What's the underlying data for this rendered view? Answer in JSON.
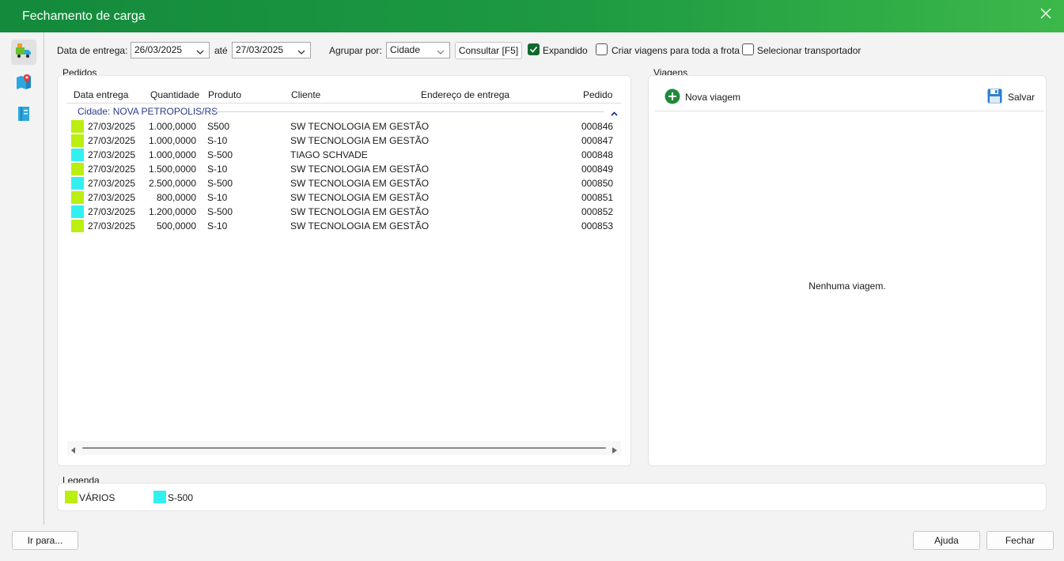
{
  "window": {
    "title": "Fechamento de carga"
  },
  "toolbar": {
    "date_label": "Data de entrega:",
    "date_from": "26/03/2025",
    "ate_label": "até",
    "date_to": "27/03/2025",
    "group_label": "Agrupar por:",
    "group_value": "Cidade",
    "consult_button": "Consultar [F5]",
    "expandido_label": "Expandido",
    "expandido_checked": true,
    "criar_label": "Criar viagens para toda a frota",
    "criar_checked": false,
    "selecionar_label": "Selecionar transportador",
    "selecionar_checked": false
  },
  "pedidos": {
    "section_label": "Pedidos",
    "columns": [
      "Data entrega",
      "Quantidade",
      "Produto",
      "Cliente",
      "Endereço de entrega",
      "Pedido"
    ],
    "group_label": "Cidade: NOVA PETROPOLIS/RS",
    "rows": [
      {
        "color": "#bbee11",
        "date": "27/03/2025",
        "qty": "1.000,0000",
        "product": "S500",
        "client": "SW TECNOLOGIA EM GESTÃO",
        "address": "",
        "order": "000846"
      },
      {
        "color": "#bbee11",
        "date": "27/03/2025",
        "qty": "1.000,0000",
        "product": "S-10",
        "client": "SW TECNOLOGIA EM GESTÃO",
        "address": "",
        "order": "000847"
      },
      {
        "color": "#33f0f0",
        "date": "27/03/2025",
        "qty": "1.000,0000",
        "product": "S-500",
        "client": "TIAGO SCHVADE",
        "address": "",
        "order": "000848"
      },
      {
        "color": "#bbee11",
        "date": "27/03/2025",
        "qty": "1.500,0000",
        "product": "S-10",
        "client": "SW TECNOLOGIA EM GESTÃO",
        "address": "",
        "order": "000849"
      },
      {
        "color": "#33f0f0",
        "date": "27/03/2025",
        "qty": "2.500,0000",
        "product": "S-500",
        "client": "SW TECNOLOGIA EM GESTÃO",
        "address": "",
        "order": "000850"
      },
      {
        "color": "#bbee11",
        "date": "27/03/2025",
        "qty": "800,0000",
        "product": "S-10",
        "client": "SW TECNOLOGIA EM GESTÃO",
        "address": "",
        "order": "000851"
      },
      {
        "color": "#33f0f0",
        "date": "27/03/2025",
        "qty": "1.200,0000",
        "product": "S-500",
        "client": "SW TECNOLOGIA EM GESTÃO",
        "address": "",
        "order": "000852"
      },
      {
        "color": "#bbee11",
        "date": "27/03/2025",
        "qty": "500,0000",
        "product": "S-10",
        "client": "SW TECNOLOGIA EM GESTÃO",
        "address": "",
        "order": "000853"
      }
    ]
  },
  "viagens": {
    "section_label": "Viagens",
    "new_trip_button": "Nova viagem",
    "save_button": "Salvar",
    "empty_text": "Nenhuma viagem."
  },
  "legenda": {
    "section_label": "Legenda",
    "items": [
      {
        "color": "#bbee11",
        "label": "VÁRIOS"
      },
      {
        "color": "#33f0f0",
        "label": "S-500"
      }
    ]
  },
  "footer": {
    "goto_button": "Ir para...",
    "help_button": "Ajuda",
    "close_button": "Fechar"
  },
  "icons": {
    "sidebar": [
      "truck-loading-icon",
      "map-pin-icon",
      "document-icon"
    ],
    "title_close": "close-icon"
  }
}
